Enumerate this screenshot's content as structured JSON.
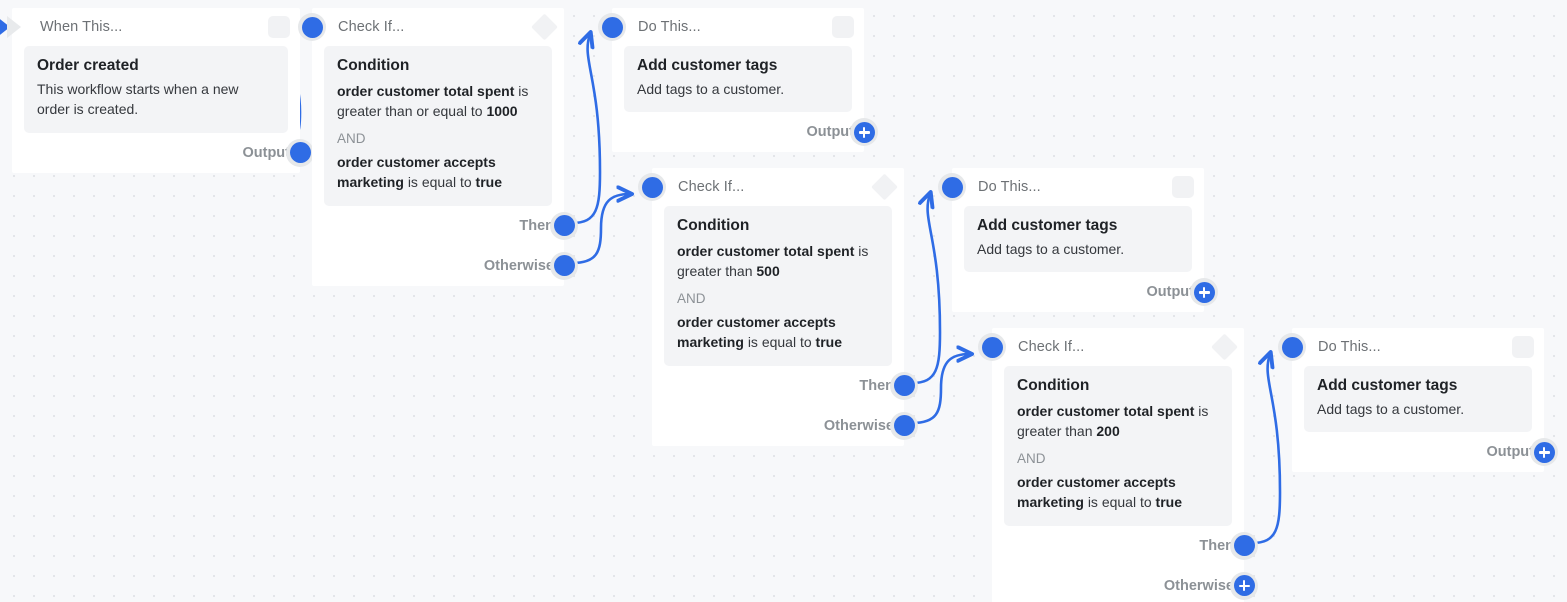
{
  "canvas": {
    "background_color": "#f7f8fa",
    "accent_color": "#2f6ce5",
    "port_ring_color": "#e6e8ea",
    "card_color": "#f3f4f6"
  },
  "labels": {
    "trigger_header": "When This...",
    "condition_header": "Check If...",
    "action_header": "Do This...",
    "output": "Output",
    "then": "Then",
    "otherwise": "Otherwise",
    "condition_title": "Condition",
    "and": "AND"
  },
  "icons": {
    "trigger": "play-triangle-icon",
    "action": "rounded-square-icon",
    "condition": "diamond-icon",
    "add": "plus-icon"
  },
  "nodes": [
    {
      "id": "trigger-1",
      "type": "trigger",
      "header": "When This...",
      "card_title": "Order created",
      "card_sub": "This workflow starts when a new order is created.",
      "ports": [
        {
          "label": "Output",
          "kind": "connected"
        }
      ]
    },
    {
      "id": "condition-1",
      "type": "condition",
      "header": "Check If...",
      "card_title": "Condition",
      "clause_1_subject": "order customer total spent",
      "clause_1_operator": "is greater than or equal to",
      "clause_1_value": "1000",
      "conjunction": "AND",
      "clause_2_subject": "order customer accepts marketing",
      "clause_2_operator": "is equal to",
      "clause_2_value": "true",
      "ports": [
        {
          "label": "Then",
          "kind": "connected"
        },
        {
          "label": "Otherwise",
          "kind": "connected"
        }
      ]
    },
    {
      "id": "action-1",
      "type": "action",
      "header": "Do This...",
      "card_title": "Add customer tags",
      "card_sub": "Add tags to a customer.",
      "ports": [
        {
          "label": "Output",
          "kind": "add"
        }
      ]
    },
    {
      "id": "condition-2",
      "type": "condition",
      "header": "Check If...",
      "card_title": "Condition",
      "clause_1_subject": "order customer total spent",
      "clause_1_operator": "is greater than",
      "clause_1_value": "500",
      "conjunction": "AND",
      "clause_2_subject": "order customer accepts marketing",
      "clause_2_operator": "is equal to",
      "clause_2_value": "true",
      "ports": [
        {
          "label": "Then",
          "kind": "connected"
        },
        {
          "label": "Otherwise",
          "kind": "connected"
        }
      ]
    },
    {
      "id": "action-2",
      "type": "action",
      "header": "Do This...",
      "card_title": "Add customer tags",
      "card_sub": "Add tags to a customer.",
      "ports": [
        {
          "label": "Output",
          "kind": "add"
        }
      ]
    },
    {
      "id": "condition-3",
      "type": "condition",
      "header": "Check If...",
      "card_title": "Condition",
      "clause_1_subject": "order customer total spent",
      "clause_1_operator": "is greater than",
      "clause_1_value": "200",
      "conjunction": "AND",
      "clause_2_subject": "order customer accepts marketing",
      "clause_2_operator": "is equal to",
      "clause_2_value": "true",
      "ports": [
        {
          "label": "Then",
          "kind": "connected"
        },
        {
          "label": "Otherwise",
          "kind": "add"
        }
      ]
    },
    {
      "id": "action-3",
      "type": "action",
      "header": "Do This...",
      "card_title": "Add customer tags",
      "card_sub": "Add tags to a customer.",
      "ports": [
        {
          "label": "Output",
          "kind": "add"
        }
      ]
    }
  ]
}
